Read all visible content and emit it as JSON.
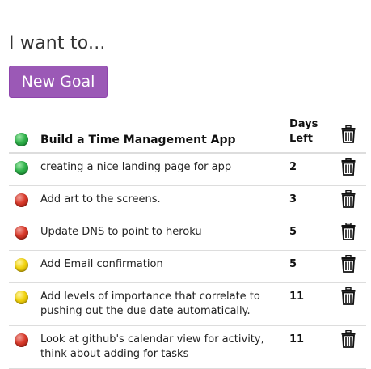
{
  "heading": "I want to...",
  "new_goal_label": "New Goal",
  "goal": {
    "title": "Build a Time Management App",
    "days_header_line1": "Days",
    "days_header_line2": "Left",
    "status": "green"
  },
  "tasks": [
    {
      "text": "creating a nice landing page for app",
      "days": "2",
      "status": "green"
    },
    {
      "text": "Add art to the screens.",
      "days": "3",
      "status": "red"
    },
    {
      "text": "Update DNS to point to heroku",
      "days": "5",
      "status": "red"
    },
    {
      "text": "Add Email confirmation",
      "days": "5",
      "status": "yellow"
    },
    {
      "text": "Add levels of importance that correlate to pushing out the due date automatically.",
      "days": "11",
      "status": "yellow"
    },
    {
      "text": "Look at github's calendar view for activity, think about adding for tasks",
      "days": "11",
      "status": "red"
    }
  ],
  "icons": {
    "status": "circle-status-icon",
    "delete": "trash-icon"
  },
  "colors": {
    "button": "#9b59b6",
    "green": "#2fb14a",
    "red": "#d93a2b",
    "yellow": "#f1d20d"
  }
}
